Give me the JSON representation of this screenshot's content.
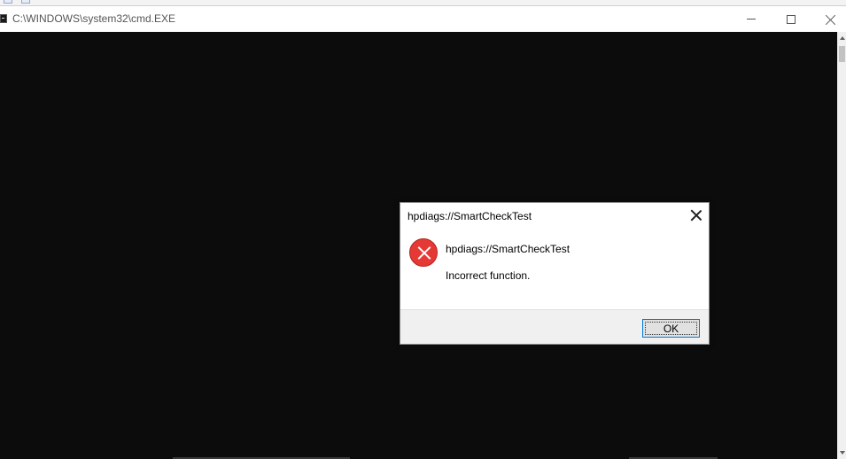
{
  "window": {
    "title": "C:\\WINDOWS\\system32\\cmd.EXE",
    "controls": {
      "minimize": "minimize",
      "maximize": "maximize",
      "close": "close"
    }
  },
  "console": {
    "background": "#0c0c0c"
  },
  "dialog": {
    "title": "hpdiags://SmartCheckTest",
    "heading": "hpdiags://SmartCheckTest",
    "message": "Incorrect function.",
    "icon": "error-icon",
    "ok_label": "OK",
    "accent": "#0078d7",
    "error_color": "#e53935"
  }
}
